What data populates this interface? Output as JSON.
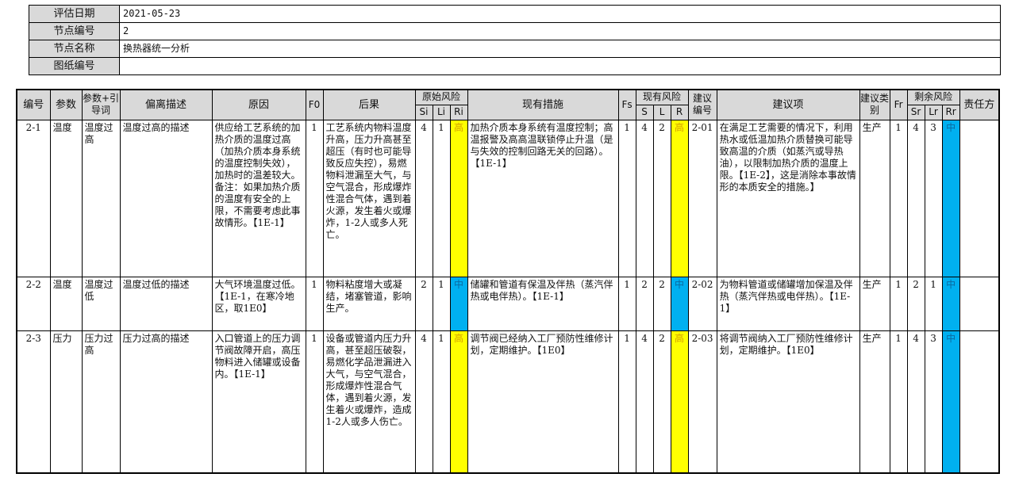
{
  "meta": {
    "date_label": "评估日期",
    "date_value": "2021-05-23",
    "node_no_label": "节点编号",
    "node_no_value": "2",
    "node_name_label": "节点名称",
    "node_name_value": "换热器统一分析",
    "drawing_no_label": "图纸编号",
    "drawing_no_value": ""
  },
  "headers": {
    "no": "编号",
    "param": "参数",
    "guideword": "参数+引导词",
    "deviation": "偏离描述",
    "cause": "原因",
    "f0": "F0",
    "consequence": "后果",
    "orig_risk": "原始风险",
    "si": "Si",
    "li": "Li",
    "ri": "Ri",
    "measures": "现有措施",
    "fs": "Fs",
    "curr_risk": "现有风险",
    "s": "S",
    "l": "L",
    "r": "R",
    "rec_no": "建议编号",
    "rec": "建议项",
    "rec_type": "建议类别",
    "fr": "Fr",
    "res_risk": "剩余风险",
    "sr": "Sr",
    "lr": "Lr",
    "rr": "Rr",
    "owner": "责任方"
  },
  "rows": [
    {
      "no": "2-1",
      "param": "温度",
      "guideword": "温度过高",
      "deviation": "温度过高的描述",
      "cause": "供应给工艺系统的加热介质的温度过高（加热介质本身系统的温度控制失效），加热时的温差较大。备注：如果加热介质的温度有安全的上限，不需要考虑此事故情形。【1E-1】",
      "f0": "1",
      "consequence": "工艺系统内物料温度升高，压力升高甚至超压（有时也可能导致反应失控），易燃物料泄漏至大气，与空气混合，形成爆炸性混合气体，遇到着火源，发生着火或爆炸，1-2人或多人死亡。",
      "si": "4",
      "li": "1",
      "ri": "高",
      "measures": "加热介质本身系统有温度控制；高温报警及高高温联锁停止升温（是与失效的控制回路无关的回路）。【1E-1】",
      "fs": "1",
      "s": "4",
      "l": "2",
      "r": "高",
      "rec_no": "2-01",
      "rec": "在满足工艺需要的情况下，利用热水或低温加热介质替换可能导致高温的介质（如蒸汽或导热油），以限制加热介质的温度上限。【1E-2】，这是消除本事故情形的本质安全的措施。】",
      "rec_type": "生产",
      "fr": "1",
      "sr": "4",
      "lr": "3",
      "rr": "中",
      "owner": ""
    },
    {
      "no": "2-2",
      "param": "温度",
      "guideword": "温度过低",
      "deviation": "温度过低的描述",
      "cause": "大气环境温度过低。【1E-1，在寒冷地区，取1E0】",
      "f0": "1",
      "consequence": "物料粘度增大或凝结，堵塞管道，影响生产。",
      "si": "2",
      "li": "1",
      "ri": "中",
      "measures": "储罐和管道有保温及伴热（蒸汽伴热或电伴热）。【1E-1】",
      "fs": "1",
      "s": "2",
      "l": "2",
      "r": "中",
      "rec_no": "2-02",
      "rec": "为物料管道或储罐增加保温及伴热（蒸汽伴热或电伴热）。【1E-1】",
      "rec_type": "生产",
      "fr": "1",
      "sr": "2",
      "lr": "1",
      "rr": "中",
      "owner": ""
    },
    {
      "no": "2-3",
      "param": "压力",
      "guideword": "压力过高",
      "deviation": "压力过高的描述",
      "cause": "入口管道上的压力调节阀故障开启，高压物料进入储罐或设备内。【1E-1】",
      "f0": "1",
      "consequence": "设备或管道内压力升高，甚至超压破裂，易燃化学品泄漏进入大气，与空气混合，形成爆炸性混合气体，遇到着火源，发生着火或爆炸，造成1-2人或多人伤亡。",
      "si": "4",
      "li": "1",
      "ri": "高",
      "measures": "调节阀已经纳入工厂预防性维修计划，定期维护。【1E0】",
      "fs": "1",
      "s": "4",
      "l": "2",
      "r": "高",
      "rec_no": "2-03",
      "rec": "将调节阀纳入工厂预防性维修计划，定期维护。【1E0】",
      "rec_type": "生产",
      "fr": "1",
      "sr": "4",
      "lr": "3",
      "rr": "中",
      "owner": ""
    }
  ],
  "colors": {
    "high": "#ffff00",
    "mid": "#00b0f0",
    "header_bg": "#d9d9d9"
  }
}
